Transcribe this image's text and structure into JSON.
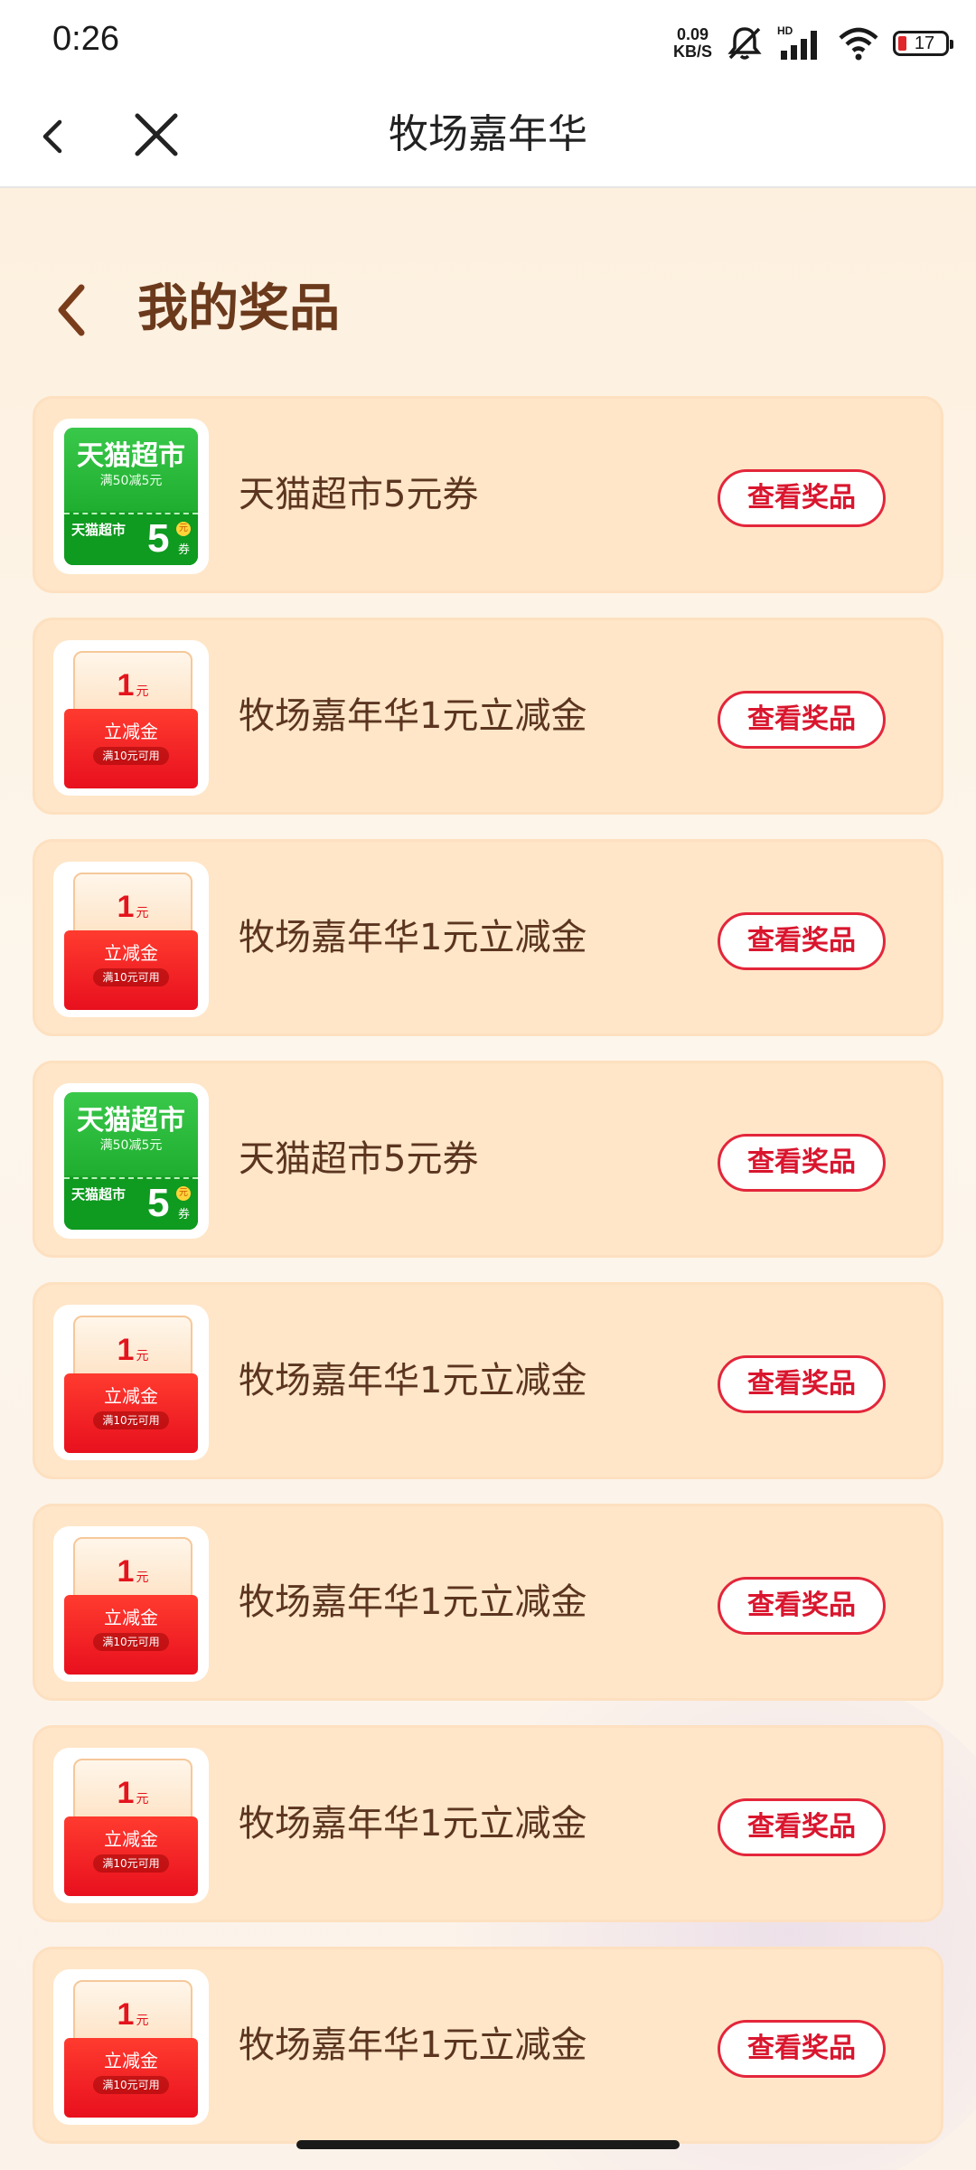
{
  "status_bar": {
    "time": "0:26",
    "net_speed_value": "0.09",
    "net_speed_unit": "KB/S",
    "network_type": "HD",
    "battery_level": "17",
    "battery_color": "#e0262a"
  },
  "nav": {
    "title": "牧场嘉年华",
    "back_icon": "chevron-left-icon",
    "close_icon": "close-icon"
  },
  "page": {
    "title": "我的奖品"
  },
  "colors": {
    "page_title": "#6b3a1c",
    "card_bg": "#ffe6c8",
    "button_accent": "#e3263b"
  },
  "prizes": [
    {
      "name": "天猫超市5元券",
      "button": "查看奖品",
      "thumb": {
        "kind": "tmall",
        "title": "天猫超市",
        "condition": "满50减5元",
        "brand": "天猫超市",
        "amount": "5",
        "unit": "券",
        "yen": "元"
      }
    },
    {
      "name": "牧场嘉年华1元立减金",
      "button": "查看奖品",
      "thumb": {
        "kind": "red",
        "amount": "1",
        "unit": "元",
        "label": "立减金",
        "condition": "满10元可用"
      }
    },
    {
      "name": "牧场嘉年华1元立减金",
      "button": "查看奖品",
      "thumb": {
        "kind": "red",
        "amount": "1",
        "unit": "元",
        "label": "立减金",
        "condition": "满10元可用"
      }
    },
    {
      "name": "天猫超市5元券",
      "button": "查看奖品",
      "thumb": {
        "kind": "tmall",
        "title": "天猫超市",
        "condition": "满50减5元",
        "brand": "天猫超市",
        "amount": "5",
        "unit": "券",
        "yen": "元"
      }
    },
    {
      "name": "牧场嘉年华1元立减金",
      "button": "查看奖品",
      "thumb": {
        "kind": "red",
        "amount": "1",
        "unit": "元",
        "label": "立减金",
        "condition": "满10元可用"
      }
    },
    {
      "name": "牧场嘉年华1元立减金",
      "button": "查看奖品",
      "thumb": {
        "kind": "red",
        "amount": "1",
        "unit": "元",
        "label": "立减金",
        "condition": "满10元可用"
      }
    },
    {
      "name": "牧场嘉年华1元立减金",
      "button": "查看奖品",
      "thumb": {
        "kind": "red",
        "amount": "1",
        "unit": "元",
        "label": "立减金",
        "condition": "满10元可用"
      }
    },
    {
      "name": "牧场嘉年华1元立减金",
      "button": "查看奖品",
      "thumb": {
        "kind": "red",
        "amount": "1",
        "unit": "元",
        "label": "立减金",
        "condition": "满10元可用"
      }
    }
  ]
}
